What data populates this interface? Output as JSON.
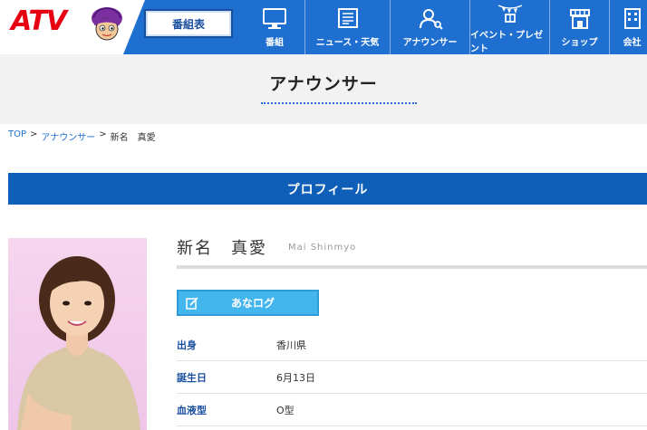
{
  "header": {
    "logo_text": "ATV",
    "schedule_label": "番組表",
    "nav": [
      {
        "label": "番組",
        "icon": "tv-icon"
      },
      {
        "label": "ニュース・天気",
        "icon": "newspaper-icon"
      },
      {
        "label": "アナウンサー",
        "icon": "announcer-icon"
      },
      {
        "label": "イベント・プレゼント",
        "icon": "event-icon"
      },
      {
        "label": "ショップ",
        "icon": "shop-icon"
      },
      {
        "label": "会社",
        "icon": "company-icon"
      }
    ]
  },
  "page": {
    "title": "アナウンサー"
  },
  "breadcrumb": {
    "top": "TOP",
    "sep1": ">",
    "section": "アナウンサー",
    "sep2": ">",
    "current": "新名　真愛"
  },
  "profile": {
    "heading": "プロフィール",
    "name_jp": "新名　真愛",
    "name_en": "Mai Shinmyo",
    "blog_label": "あなログ",
    "info": [
      {
        "label": "出身",
        "value": "香川県"
      },
      {
        "label": "誕生日",
        "value": "6月13日"
      },
      {
        "label": "血液型",
        "value": "O型"
      }
    ]
  },
  "colors": {
    "header_blue": "#1e6fd0",
    "profile_bar": "#0f5fb8",
    "logo_red": "#e60012",
    "blog_button": "#44b6ee",
    "label_blue": "#1a4fa0"
  }
}
